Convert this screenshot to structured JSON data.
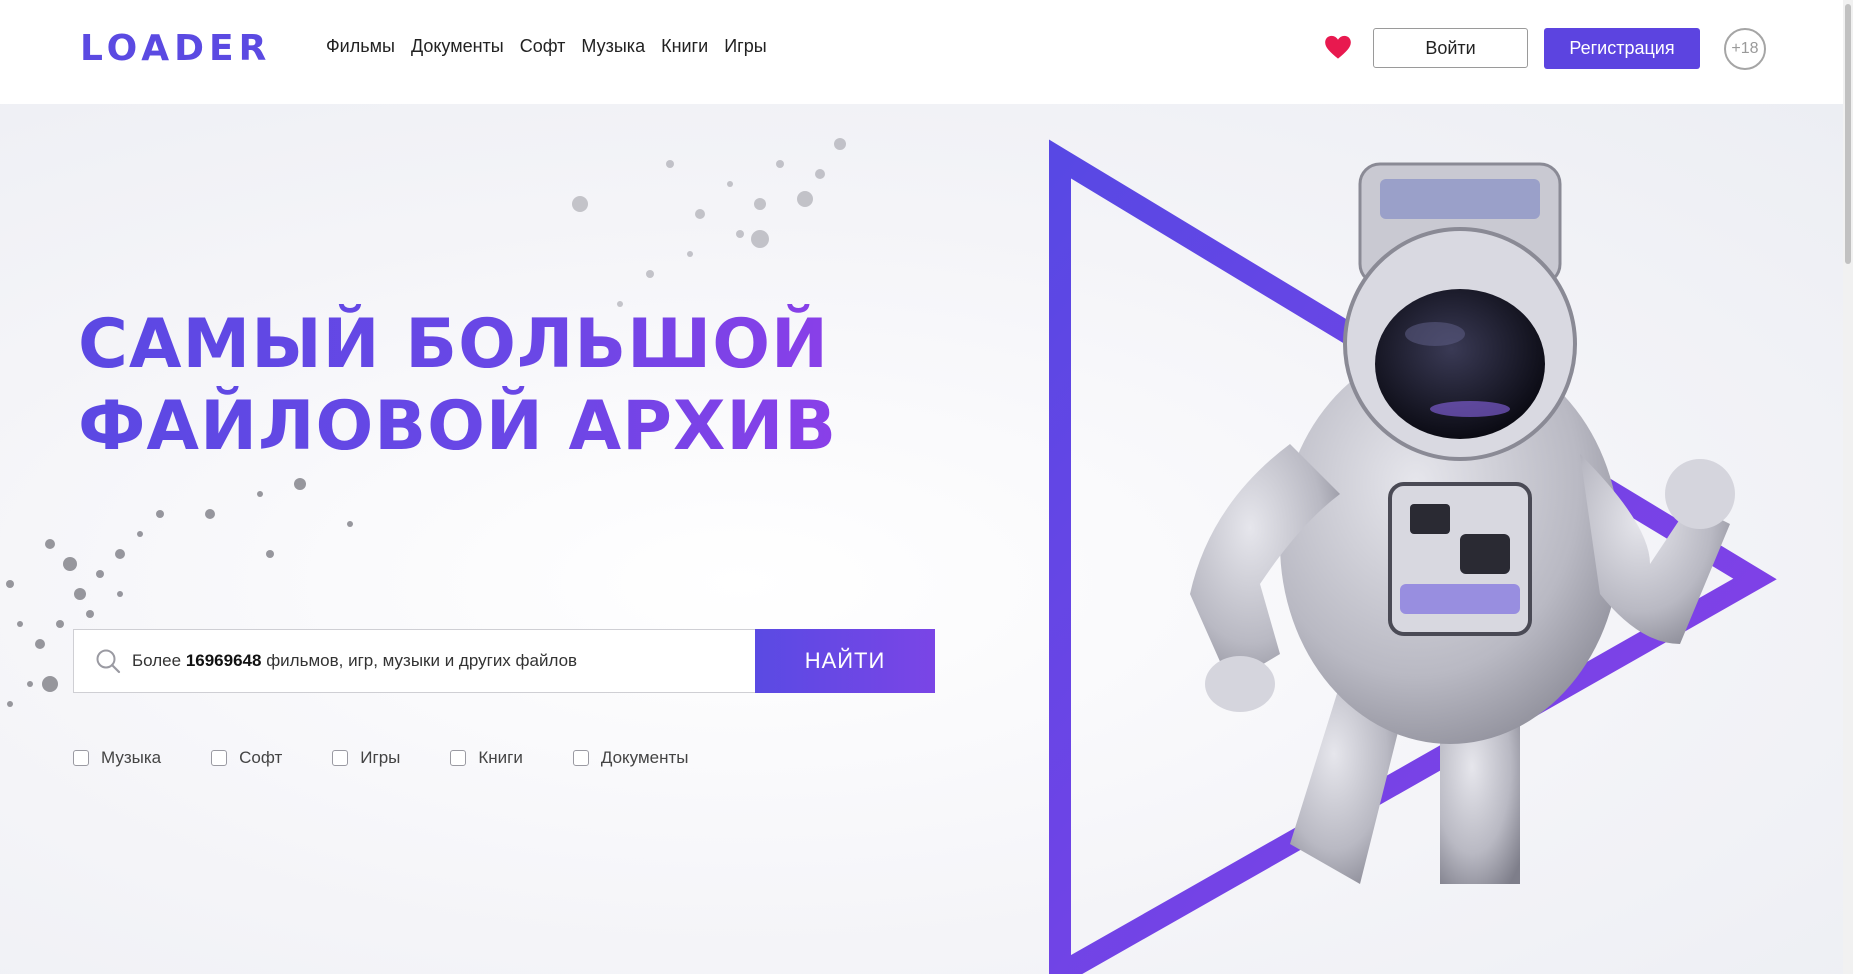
{
  "header": {
    "logo": "LOADER",
    "nav": [
      "Фильмы",
      "Документы",
      "Софт",
      "Музыка",
      "Книги",
      "Игры"
    ],
    "login_label": "Войти",
    "register_label": "Регистрация",
    "age_badge": "+18"
  },
  "hero": {
    "headline_line1": "Самый большой",
    "headline_line2": "файловой архив",
    "search": {
      "prefix": "Более",
      "count": "16969648",
      "suffix": "фильмов, игр, музыки и других файлов",
      "button_label": "НАЙТИ"
    },
    "filters": [
      "Музыка",
      "Софт",
      "Игры",
      "Книги",
      "Документы"
    ]
  },
  "colors": {
    "accent": "#5c44e0",
    "accent_gradient_end": "#8a3fe8",
    "heart": "#e8194f"
  }
}
